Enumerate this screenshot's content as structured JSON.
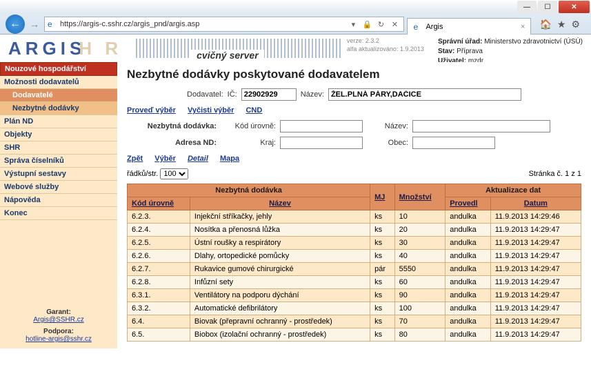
{
  "browser": {
    "url": "https://argis-c.sshr.cz/argis_pnd/argis.asp",
    "tab_title": "Argis"
  },
  "header": {
    "logo": "ARGIS",
    "logo_shadow": "H R",
    "server_label": "cvičný server",
    "version_label": "verze: 2.3.2",
    "alfa_label": "alfa aktualizováno: 1.9.2013",
    "admin_label": "Správní úřad:",
    "admin_value": "Ministerstvo zdravotnictví (ÚSÚ)",
    "state_label": "Stav:",
    "state_value": "Příprava",
    "user_label": "Uživatel:",
    "user_value": "mzdr"
  },
  "sidebar": {
    "section1": "Nouzové hospodářství",
    "item_moznosti": "Možnosti dodavatelů",
    "item_dodavatele": "Dodavatelé",
    "item_nezbytne": "Nezbytné dodávky",
    "item_plan": "Plán ND",
    "item_objekty": "Objekty",
    "item_shr": "SHR",
    "item_sprava": "Správa číselníků",
    "item_vystupni": "Výstupní sestavy",
    "item_webove": "Webové služby",
    "item_napoveda": "Nápověda",
    "item_konec": "Konec",
    "garant_label": "Garant:",
    "garant_link": "Argis@SSHR.cz",
    "podpora_label": "Podpora:",
    "podpora_link": "hotline-argis@sshr.cz"
  },
  "main": {
    "title": "Nezbytné dodávky poskytované dodavatelem",
    "dodavatel_label": "Dodavatel:",
    "ic_label": "IČ:",
    "ic_value": "22902929",
    "nazev_label": "Název:",
    "nazev_value": "ŽEL.PLNÁ PÁRY,DAČICE",
    "link_proved": "Proveď výběr",
    "link_vycisti": "Vyčisti výběr",
    "link_cnd": "CND",
    "nd_label": "Nezbytná dodávka:",
    "kod_label": "Kód úrovně:",
    "nazev2_label": "Název:",
    "adresa_label": "Adresa ND:",
    "kraj_label": "Kraj:",
    "obec_label": "Obec:",
    "link_zpet": "Zpět",
    "link_vyber": "Výběr",
    "link_detail": "Detail",
    "link_mapa": "Mapa",
    "rows_label": "řádků/str.",
    "rows_value": "100",
    "page_label": "Stránka č. 1 z 1",
    "th_grp1": "Nezbytná dodávka",
    "th_grp2": "Aktualizace dat",
    "th_kod": "Kód úrovně",
    "th_nazev": "Název",
    "th_mj": "MJ",
    "th_mnoz": "Množství",
    "th_provedl": "Provedl",
    "th_datum": "Datum",
    "rows": [
      {
        "kod": "6.2.3.",
        "nazev": "Injekční stříkačky, jehly",
        "mj": "ks",
        "mnoz": "10",
        "prov": "andulka",
        "datum": "11.9.2013 14:29:46"
      },
      {
        "kod": "6.2.4.",
        "nazev": "Nosítka a přenosná lůžka",
        "mj": "ks",
        "mnoz": "20",
        "prov": "andulka",
        "datum": "11.9.2013 14:29:47"
      },
      {
        "kod": "6.2.5.",
        "nazev": "Ústní roušky a respirátory",
        "mj": "ks",
        "mnoz": "30",
        "prov": "andulka",
        "datum": "11.9.2013 14:29:47"
      },
      {
        "kod": "6.2.6.",
        "nazev": "Dlahy, ortopedické pomůcky",
        "mj": "ks",
        "mnoz": "40",
        "prov": "andulka",
        "datum": "11.9.2013 14:29:47"
      },
      {
        "kod": "6.2.7.",
        "nazev": "Rukavice gumové chirurgické",
        "mj": "pár",
        "mnoz": "5550",
        "prov": "andulka",
        "datum": "11.9.2013 14:29:47"
      },
      {
        "kod": "6.2.8.",
        "nazev": "Infůzní sety",
        "mj": "ks",
        "mnoz": "60",
        "prov": "andulka",
        "datum": "11.9.2013 14:29:47"
      },
      {
        "kod": "6.3.1.",
        "nazev": "Ventilátory na podporu dýchání",
        "mj": "ks",
        "mnoz": "90",
        "prov": "andulka",
        "datum": "11.9.2013 14:29:47"
      },
      {
        "kod": "6.3.2.",
        "nazev": "Automatické defibrilátory",
        "mj": "ks",
        "mnoz": "100",
        "prov": "andulka",
        "datum": "11.9.2013 14:29:47"
      },
      {
        "kod": "6.4.",
        "nazev": "Biovak (přepravní ochranný - prostředek)",
        "mj": "ks",
        "mnoz": "70",
        "prov": "andulka",
        "datum": "11.9.2013 14:29:47"
      },
      {
        "kod": "6.5.",
        "nazev": "Biobox (izolační ochranný - prostředek)",
        "mj": "ks",
        "mnoz": "80",
        "prov": "andulka",
        "datum": "11.9.2013 14:29:47"
      }
    ]
  }
}
